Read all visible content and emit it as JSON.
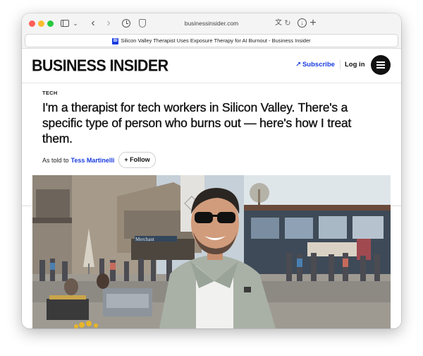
{
  "browser": {
    "url": "businessinsider.com",
    "tab_title": "Silicon Valley Therapist Uses Exposure Therapy for AI Burnout - Business Insider",
    "favicon_text": "BI"
  },
  "header": {
    "logo": "BUSINESS INSIDER",
    "subscribe": "Subscribe",
    "login": "Log in"
  },
  "article": {
    "category": "TECH",
    "headline": "I'm a therapist for tech workers in Silicon Valley. There's a specific type of person who burns out — here's how I treat them.",
    "byline_prefix": "As told to",
    "author": "Tess Martinelli",
    "follow": "+ Follow"
  },
  "photo": {
    "sign_text": "Merchant"
  },
  "colors": {
    "brand_blue": "#173be0",
    "text": "#111111"
  }
}
